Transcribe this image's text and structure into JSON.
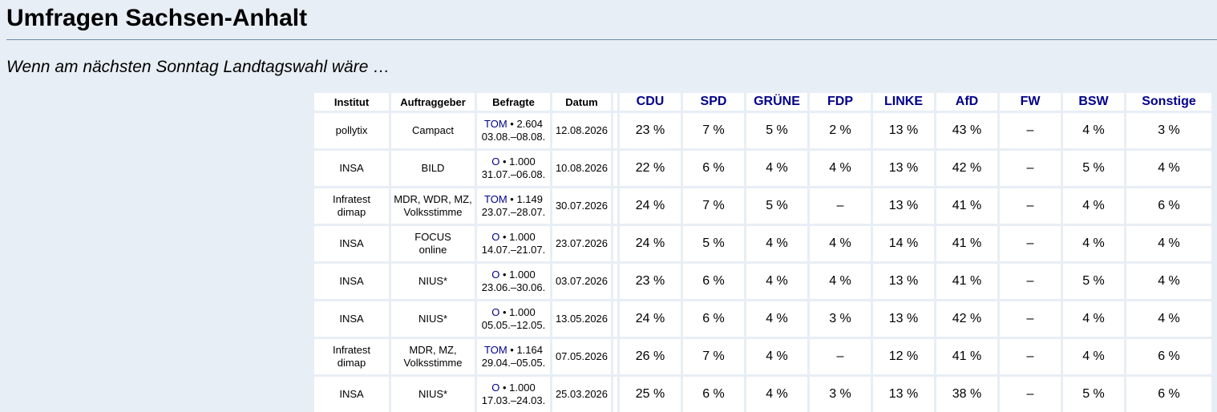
{
  "page": {
    "title": "Umfragen Sachsen-Anhalt",
    "subtitle": "Wenn am nächsten Sonntag Landtagswahl wäre …"
  },
  "table": {
    "headers": {
      "institut": "Institut",
      "auftraggeber": "Auftraggeber",
      "befragte": "Befragte",
      "datum": "Datum"
    },
    "parties": [
      "CDU",
      "SPD",
      "GRÜNE",
      "FDP",
      "LINKE",
      "AfD",
      "FW",
      "BSW",
      "Sonstige"
    ],
    "rows": [
      {
        "institut": [
          "pollytix"
        ],
        "auftraggeber": [
          "Campact"
        ],
        "method": "TOM",
        "count": " • 2.604",
        "period": "03.08.–08.08.",
        "datum": "12.08.2026",
        "values": [
          "23 %",
          "7 %",
          "5 %",
          "2 %",
          "13 %",
          "43 %",
          "–",
          "4 %",
          "3 %"
        ]
      },
      {
        "institut": [
          "INSA"
        ],
        "auftraggeber": [
          "BILD"
        ],
        "method": "O",
        "count": " • 1.000",
        "period": "31.07.–06.08.",
        "datum": "10.08.2026",
        "values": [
          "22 %",
          "6 %",
          "4 %",
          "4 %",
          "13 %",
          "42 %",
          "–",
          "5 %",
          "4 %"
        ]
      },
      {
        "institut": [
          "Infratest",
          "dimap"
        ],
        "auftraggeber": [
          "MDR, WDR, MZ,",
          "Volksstimme"
        ],
        "method": "TOM",
        "count": " • 1.149",
        "period": "23.07.–28.07.",
        "datum": "30.07.2026",
        "values": [
          "24 %",
          "7 %",
          "5 %",
          "–",
          "13 %",
          "41 %",
          "–",
          "4 %",
          "6 %"
        ]
      },
      {
        "institut": [
          "INSA"
        ],
        "auftraggeber": [
          "FOCUS",
          "online"
        ],
        "method": "O",
        "count": " • 1.000",
        "period": "14.07.–21.07.",
        "datum": "23.07.2026",
        "values": [
          "24 %",
          "5 %",
          "4 %",
          "4 %",
          "14 %",
          "41 %",
          "–",
          "4 %",
          "4 %"
        ]
      },
      {
        "institut": [
          "INSA"
        ],
        "auftraggeber": [
          "NIUS*"
        ],
        "method": "O",
        "count": " • 1.000",
        "period": "23.06.–30.06.",
        "datum": "03.07.2026",
        "values": [
          "23 %",
          "6 %",
          "4 %",
          "4 %",
          "13 %",
          "41 %",
          "–",
          "5 %",
          "4 %"
        ]
      },
      {
        "institut": [
          "INSA"
        ],
        "auftraggeber": [
          "NIUS*"
        ],
        "method": "O",
        "count": " • 1.000",
        "period": "05.05.–12.05.",
        "datum": "13.05.2026",
        "values": [
          "24 %",
          "6 %",
          "4 %",
          "3 %",
          "13 %",
          "42 %",
          "–",
          "4 %",
          "4 %"
        ]
      },
      {
        "institut": [
          "Infratest",
          "dimap"
        ],
        "auftraggeber": [
          "MDR, MZ,",
          "Volksstimme"
        ],
        "method": "TOM",
        "count": " • 1.164",
        "period": "29.04.–05.05.",
        "datum": "07.05.2026",
        "values": [
          "26 %",
          "7 %",
          "4 %",
          "–",
          "12 %",
          "41 %",
          "–",
          "4 %",
          "6 %"
        ]
      },
      {
        "institut": [
          "INSA"
        ],
        "auftraggeber": [
          "NIUS*"
        ],
        "method": "O",
        "count": " • 1.000",
        "period": "17.03.–24.03.",
        "datum": "25.03.2026",
        "values": [
          "25 %",
          "6 %",
          "4 %",
          "3 %",
          "13 %",
          "38 %",
          "–",
          "5 %",
          "6 %"
        ]
      }
    ]
  }
}
